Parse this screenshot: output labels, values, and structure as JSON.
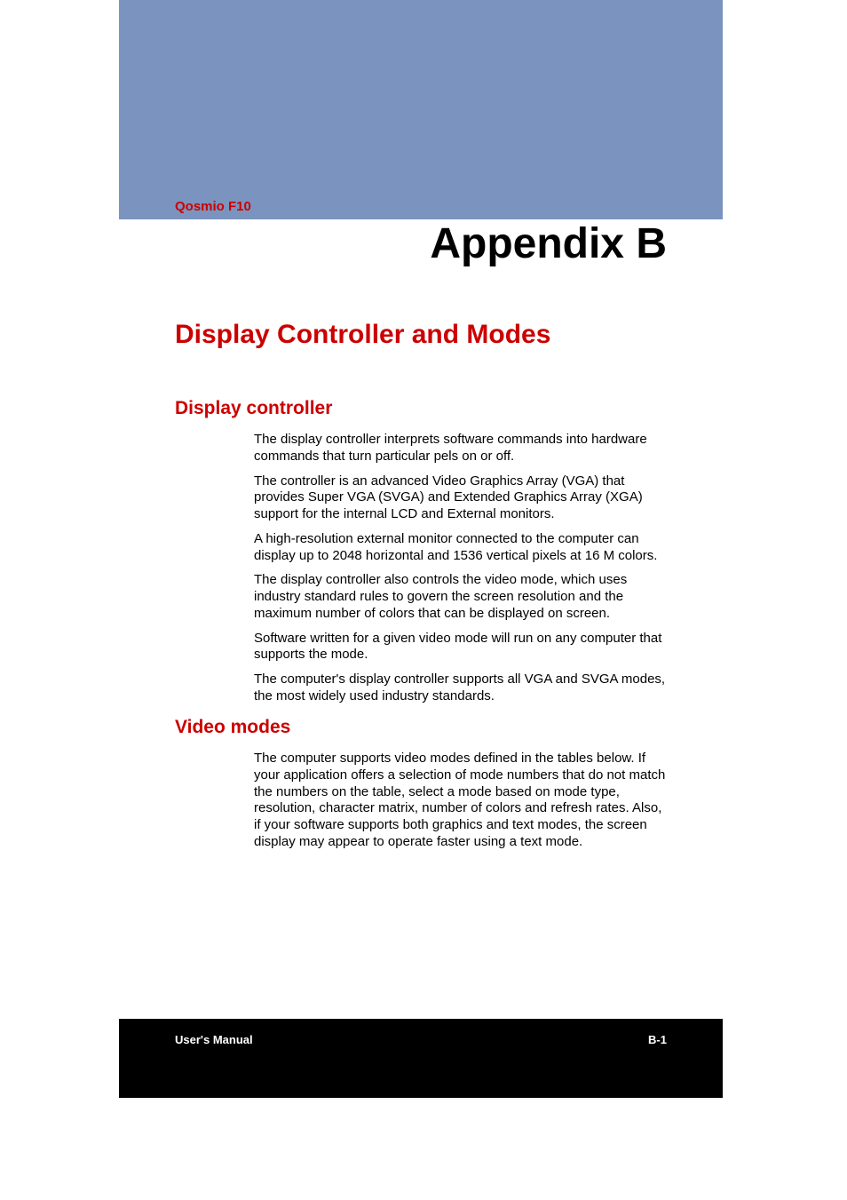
{
  "header": {
    "product": "Qosmio F10",
    "appendix": "Appendix B"
  },
  "title": "Display Controller and Modes",
  "sections": [
    {
      "heading": "Display controller",
      "paragraphs": [
        "The display controller interprets software commands into hardware commands that turn particular pels on or off.",
        "The controller is an advanced Video Graphics Array (VGA) that provides Super VGA (SVGA) and Extended Graphics Array (XGA) support for the internal LCD and External monitors.",
        "A high-resolution external monitor connected to the computer can display up to 2048 horizontal and 1536 vertical pixels at 16 M colors.",
        "The display controller also controls the video mode, which uses industry standard rules to govern the screen resolution and the maximum number of colors that can be displayed on screen.",
        "Software written for a given video mode will run on any computer that supports the mode.",
        "The computer's display controller supports all VGA and SVGA modes, the most widely used industry standards."
      ]
    },
    {
      "heading": "Video modes",
      "paragraphs": [
        "The computer supports video modes defined in the tables below. If your application offers a selection of mode numbers that do not match the numbers on the table, select a mode based on mode type, resolution, character matrix, number of colors and refresh rates. Also, if your software supports both graphics and text modes, the screen display may appear to operate faster using a text mode."
      ]
    }
  ],
  "footer": {
    "left": "User's Manual",
    "right": "B-1"
  }
}
